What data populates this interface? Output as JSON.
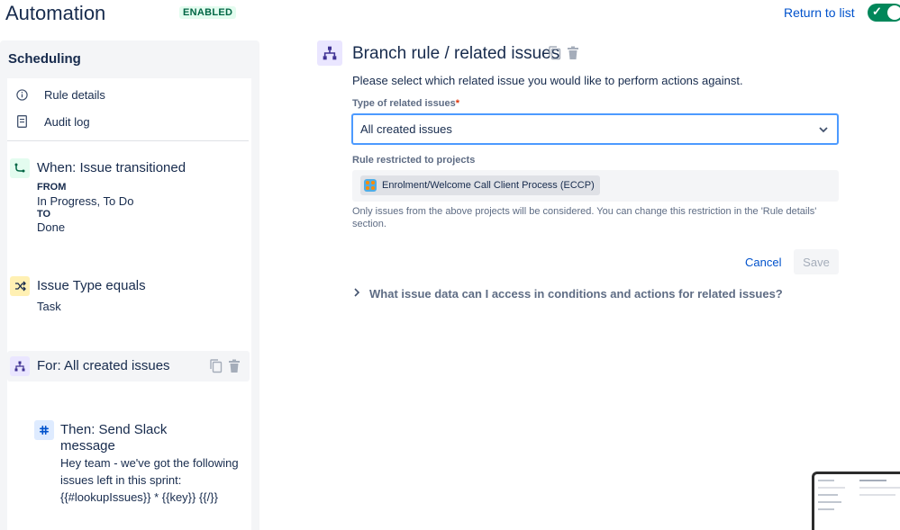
{
  "header": {
    "title": "Automation",
    "status_badge": "ENABLED",
    "return_link": "Return to list",
    "toggle_check": "✓"
  },
  "sidebar": {
    "title": "Scheduling",
    "links": [
      {
        "label": "Rule details",
        "icon": "info-icon"
      },
      {
        "label": "Audit log",
        "icon": "document-icon"
      }
    ],
    "trigger": {
      "title": "When: Issue transitioned",
      "from_label": "FROM",
      "from_value": "In Progress, To Do",
      "to_label": "TO",
      "to_value": "Done"
    },
    "condition": {
      "title": "Issue Type equals",
      "value": "Task"
    },
    "branch": {
      "title": "For: All created issues"
    },
    "action": {
      "title_line1": "Then: Send Slack",
      "title_line2": "message",
      "text_line1": "Hey team - we've got the following",
      "text_line2": "issues left in this sprint:",
      "text_line3": "{{#lookupIssues}} * {{key}} {{/}}"
    }
  },
  "main": {
    "title": "Branch rule / related issues",
    "description": "Please select which related issue you would like to perform actions against.",
    "type_label": "Type of related issues",
    "required_mark": "*",
    "type_value": "All created issues",
    "projects_label": "Rule restricted to projects",
    "project_chip": "Enrolment/Welcome Call Client Process (ECCP)",
    "help_text": "Only issues from the above projects will be considered. You can change this restriction in the 'Rule details' section.",
    "cancel_label": "Cancel",
    "save_label": "Save",
    "expander_label": "What issue data can I access in conditions and actions for related issues?"
  },
  "colors": {
    "accent": "#0052cc",
    "toggle_on": "#00875a",
    "badge_bg": "#e3fcef",
    "badge_text": "#006644",
    "branch_icon_bg": "#eae6ff",
    "trigger_icon_bg": "#e3fcef",
    "condition_icon_bg": "#fff0b3",
    "action_icon_bg": "#deebff"
  }
}
